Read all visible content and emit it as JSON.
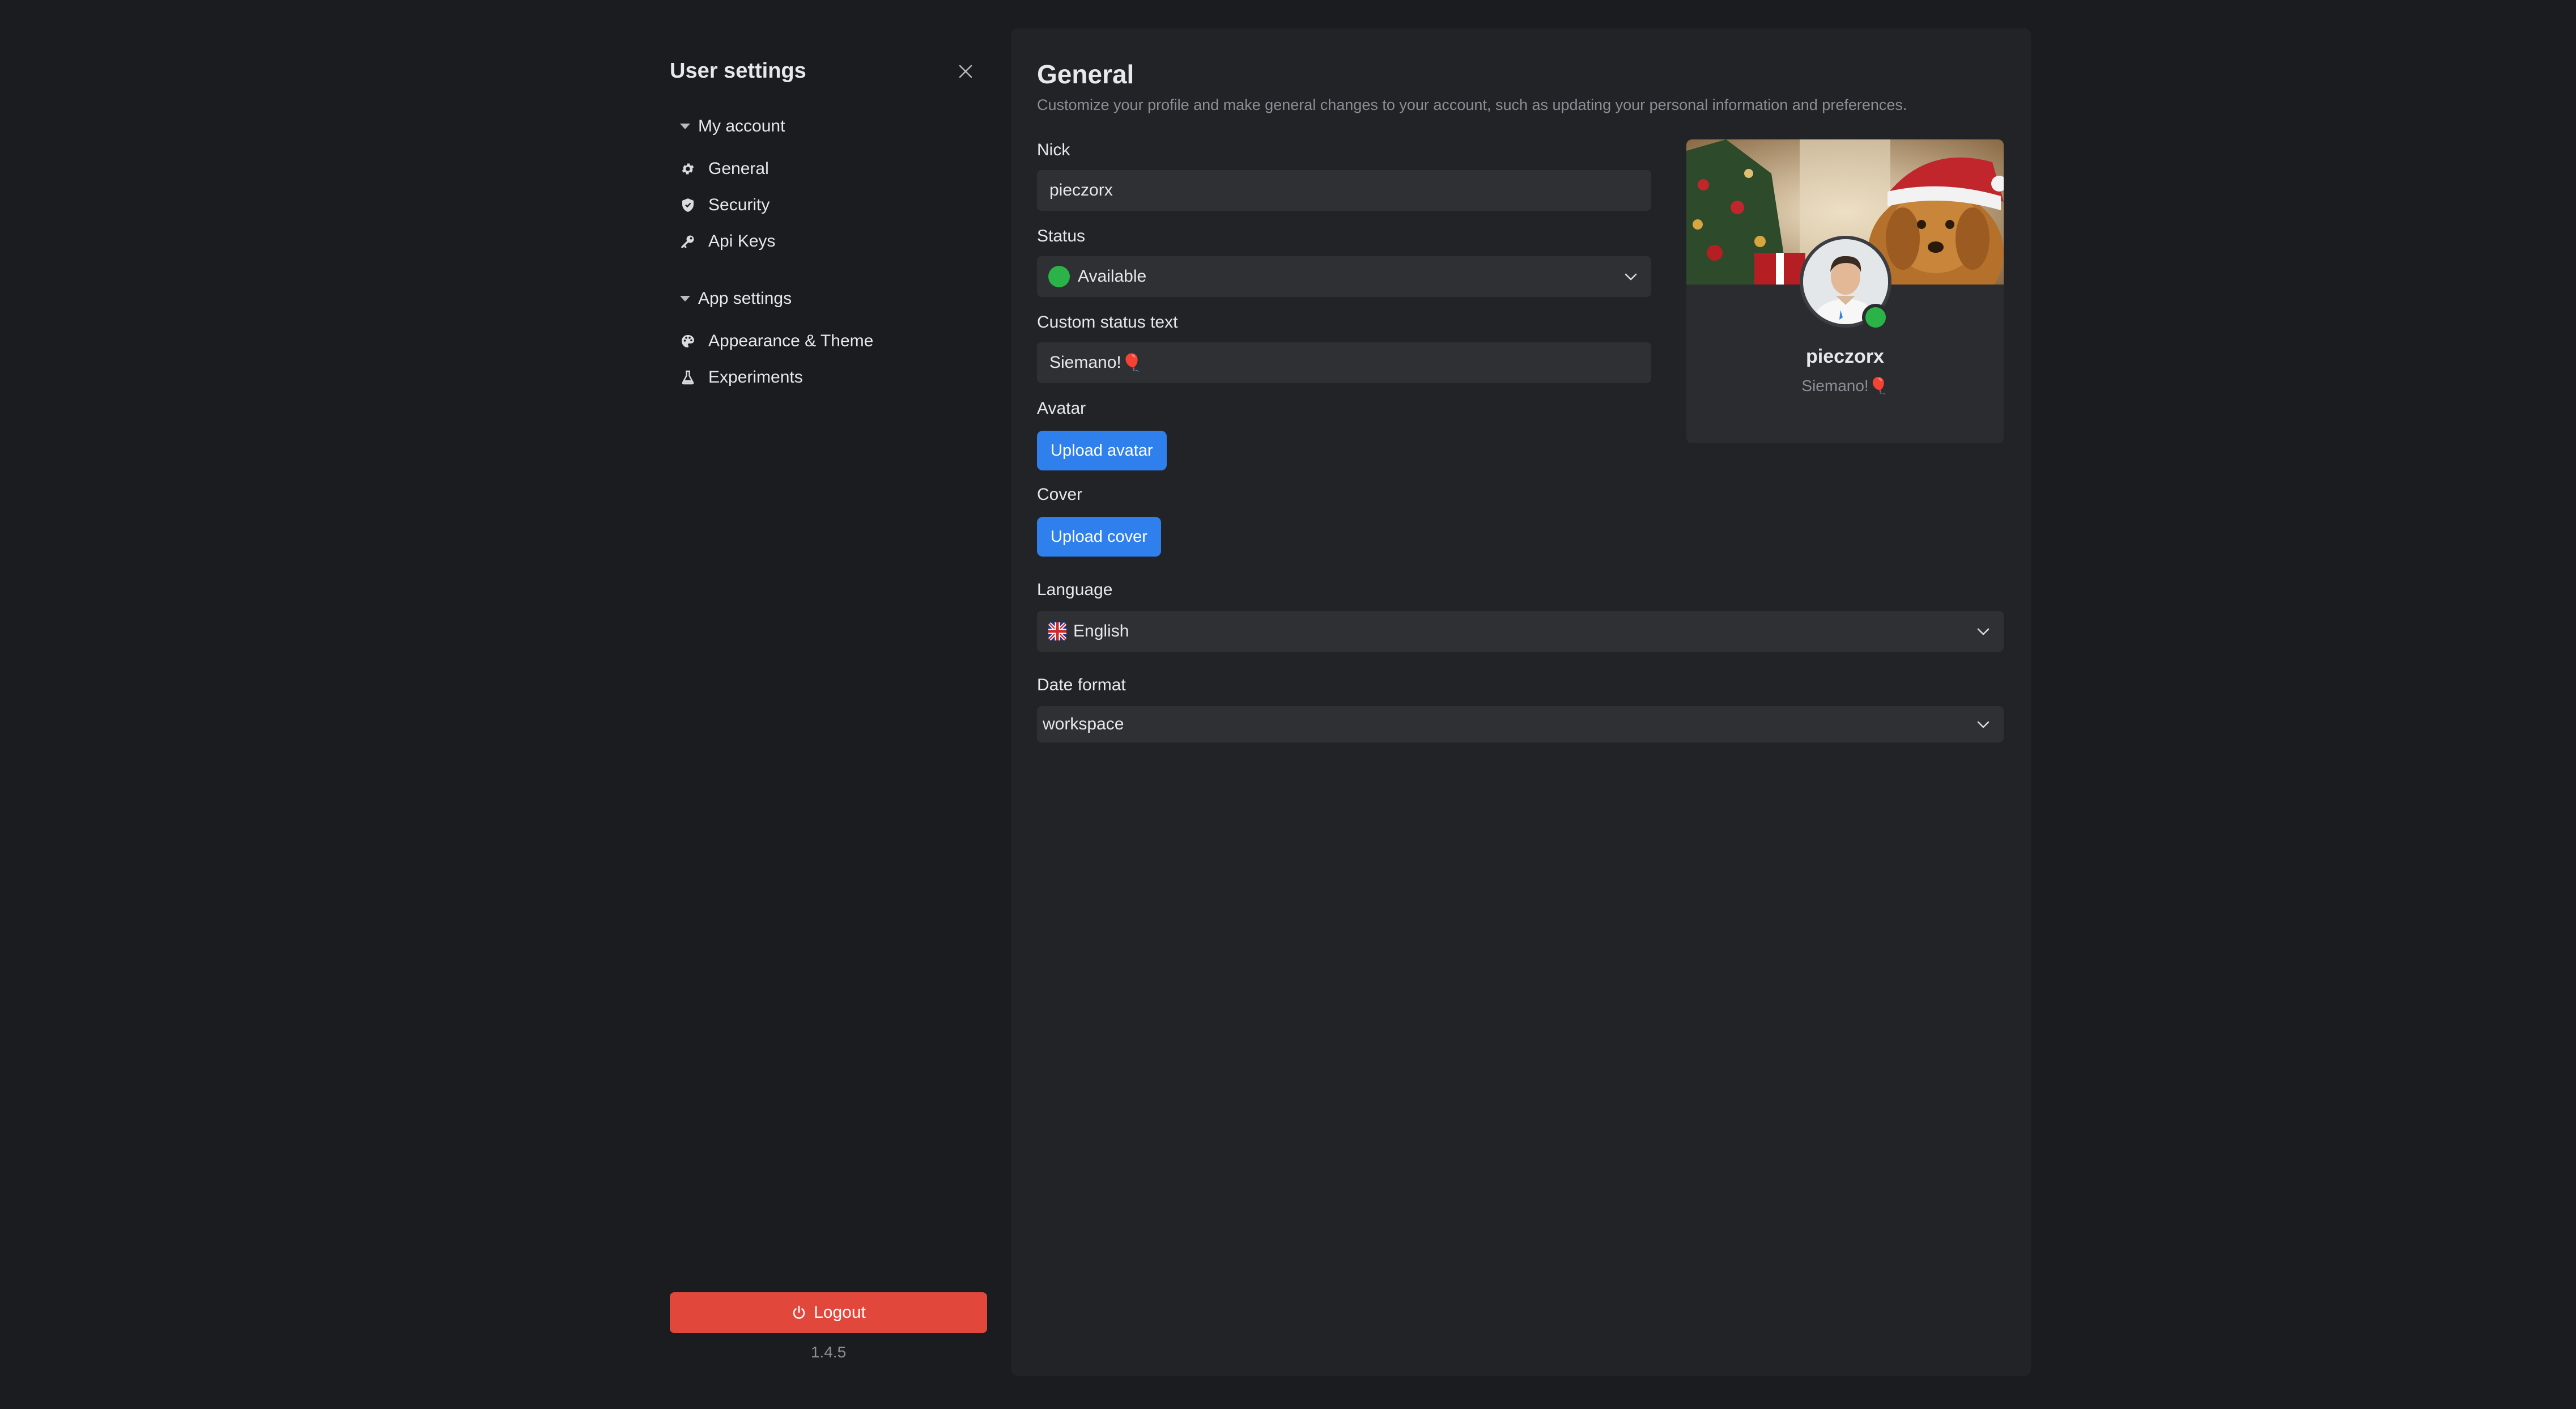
{
  "sidebar": {
    "title": "User settings",
    "groups": [
      {
        "label": "My account",
        "items": [
          {
            "label": "General",
            "icon": "gear-icon"
          },
          {
            "label": "Security",
            "icon": "shield-icon"
          },
          {
            "label": "Api Keys",
            "icon": "key-icon"
          }
        ]
      },
      {
        "label": "App settings",
        "items": [
          {
            "label": "Appearance & Theme",
            "icon": "palette-icon"
          },
          {
            "label": "Experiments",
            "icon": "flask-icon"
          }
        ]
      }
    ],
    "logout_label": "Logout",
    "version": "1.4.5"
  },
  "main": {
    "title": "General",
    "description": "Customize your profile and make general changes to your account, such as updating your personal information and preferences.",
    "nick": {
      "label": "Nick",
      "value": "pieczorx"
    },
    "status": {
      "label": "Status",
      "value": "Available",
      "color": "#2bb34a"
    },
    "custom_status": {
      "label": "Custom status text",
      "value": "Siemano!",
      "emoji": "🎈"
    },
    "avatar": {
      "label": "Avatar",
      "button": "Upload avatar"
    },
    "cover": {
      "label": "Cover",
      "button": "Upload cover"
    },
    "language": {
      "label": "Language",
      "value": "English",
      "flag": "uk-flag-icon"
    },
    "date_format": {
      "label": "Date format",
      "value": "workspace"
    }
  },
  "profile_card": {
    "name": "pieczorx",
    "status_text": "Siemano!",
    "status_emoji": "🎈"
  },
  "colors": {
    "accent": "#2f80ed",
    "danger": "#e2473c",
    "online": "#2bb34a",
    "background": "#1a1c1f",
    "panel": "#212327"
  }
}
